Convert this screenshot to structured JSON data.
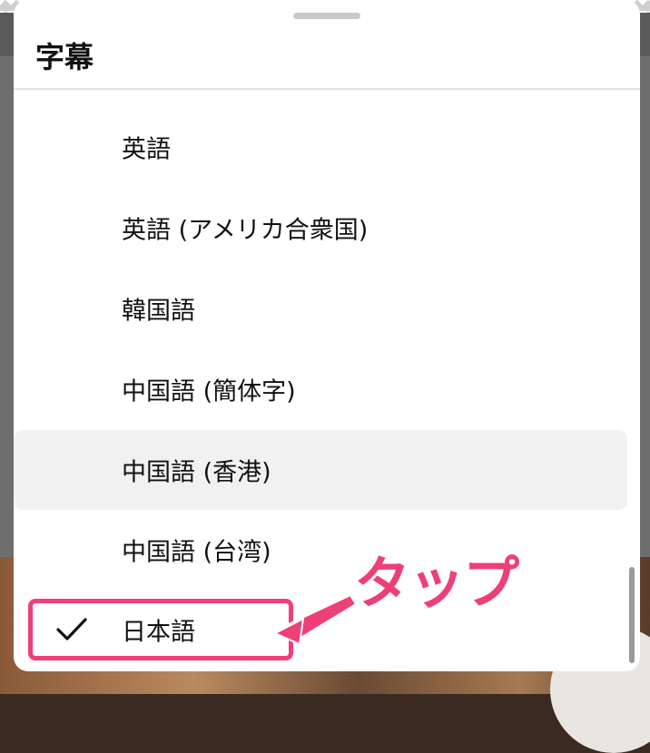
{
  "sheet": {
    "title": "字幕",
    "options": [
      {
        "label": "英語",
        "selected": false,
        "highlighted": false
      },
      {
        "label": "英語 (アメリカ合衆国)",
        "selected": false,
        "highlighted": false
      },
      {
        "label": "韓国語",
        "selected": false,
        "highlighted": false
      },
      {
        "label": "中国語 (簡体字)",
        "selected": false,
        "highlighted": false
      },
      {
        "label": "中国語 (香港)",
        "selected": false,
        "highlighted": true
      },
      {
        "label": "中国語 (台湾)",
        "selected": false,
        "highlighted": false
      },
      {
        "label": "日本語",
        "selected": true,
        "highlighted": false
      }
    ]
  },
  "annotation": {
    "text": "タップ",
    "color": "#ef3f77"
  },
  "icons": {
    "selected_marker": "checkmark-icon"
  }
}
